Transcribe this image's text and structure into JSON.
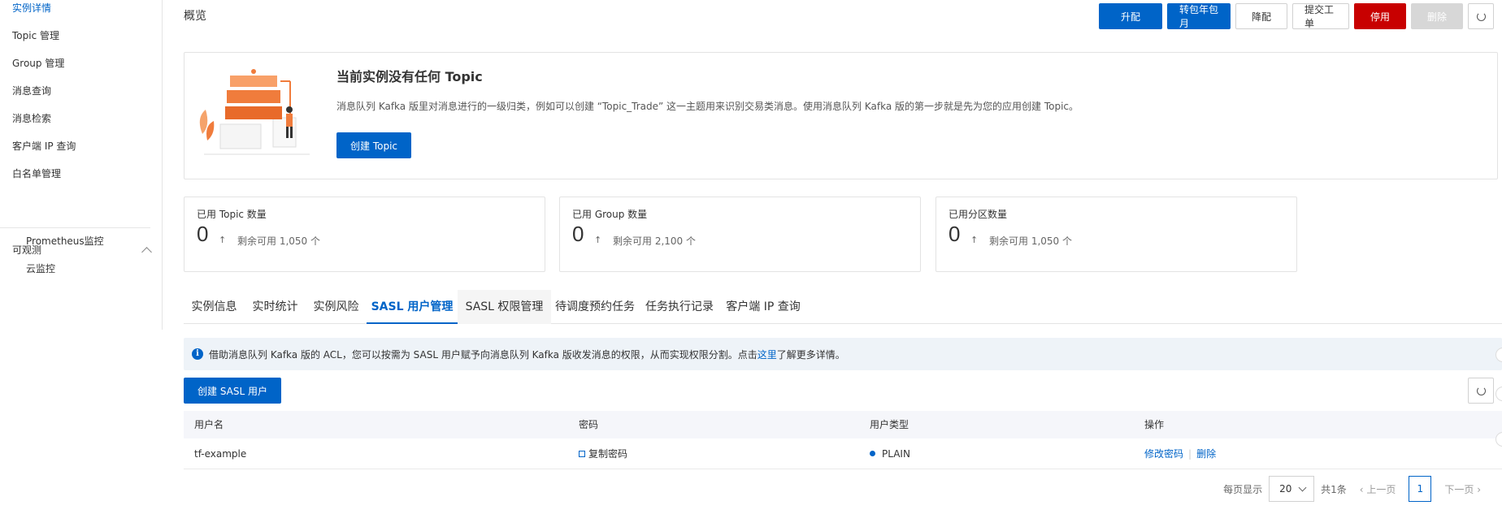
{
  "sidebar": {
    "items": [
      {
        "label": "实例详情",
        "active": true
      },
      {
        "label": "Topic 管理"
      },
      {
        "label": "Group 管理"
      },
      {
        "label": "消息查询"
      },
      {
        "label": "消息检索"
      },
      {
        "label": "客户端 IP 查询"
      },
      {
        "label": "白名单管理"
      }
    ],
    "group": {
      "label": "可观测",
      "expanded": true,
      "items": [
        "Prometheus监控",
        "云监控"
      ]
    }
  },
  "header": {
    "title": "概览",
    "buttons": {
      "upgrade": "升配",
      "to_subscription": "转包年包月",
      "downgrade": "降配",
      "ticket": "提交工单",
      "stop": "停用",
      "delete": "删除"
    }
  },
  "empty_state": {
    "title": "当前实例没有任何 Topic",
    "description": "消息队列 Kafka 版里对消息进行的一级归类，例如可以创建 “Topic_Trade” 这一主题用来识别交易类消息。使用消息队列 Kafka 版的第一步就是先为您的应用创建 Topic。",
    "button": "创建 Topic"
  },
  "stats": [
    {
      "label": "已用 Topic 数量",
      "value": "0",
      "arrow": "↑",
      "remaining": "剩余可用 1,050 个"
    },
    {
      "label": "已用 Group 数量",
      "value": "0",
      "arrow": "↑",
      "remaining": "剩余可用 2,100 个"
    },
    {
      "label": "已用分区数量",
      "value": "0",
      "arrow": "↑",
      "remaining": "剩余可用 1,050 个"
    }
  ],
  "tabs": [
    "实例信息",
    "实时统计",
    "实例风险",
    "SASL 用户管理",
    "SASL 权限管理",
    "待调度预约任务",
    "任务执行记录",
    "客户端 IP 查询"
  ],
  "active_tab": "SASL 用户管理",
  "info": {
    "icon": "info-icon",
    "text_before": "借助消息队列 Kafka 版的 ACL，您可以按需为 SASL 用户赋予向消息队列 Kafka 版收发消息的权限，从而实现权限分割。点击",
    "link": "这里",
    "text_after": "了解更多详情。"
  },
  "create_sasl_button": "创建 SASL 用户",
  "table": {
    "columns": [
      "用户名",
      "密码",
      "用户类型",
      "操作"
    ],
    "rows": [
      {
        "username": "tf-example",
        "password_action": "复制密码",
        "type": "PLAIN",
        "actions": [
          "修改密码",
          "删除"
        ]
      }
    ]
  },
  "pagination": {
    "per_page_label": "每页显示",
    "per_page": "20",
    "total": "共1条",
    "prev": "上一页",
    "current": "1",
    "next": "下一页"
  },
  "colors": {
    "primary": "#0064c8",
    "danger": "#c80000",
    "illustration": "#f07c3c"
  }
}
